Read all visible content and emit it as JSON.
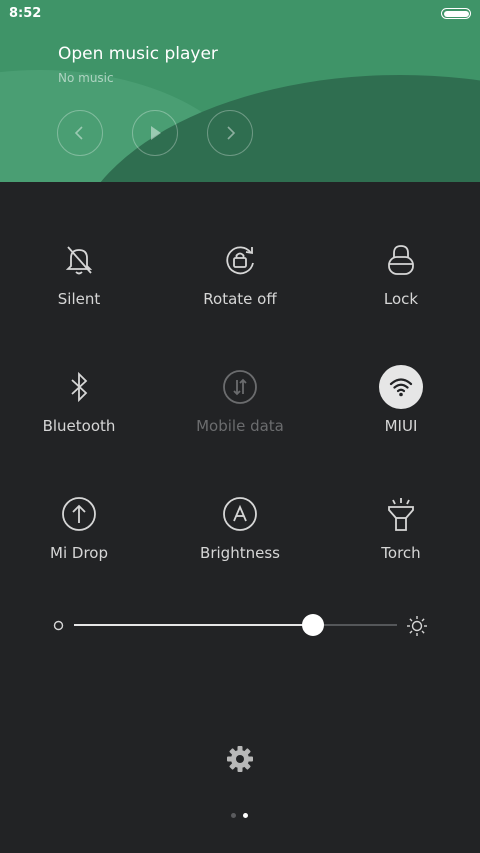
{
  "status_bar": {
    "time": "8:52"
  },
  "music": {
    "title": "Open music player",
    "subtitle": "No music",
    "prev_icon": "chevron-left-icon",
    "play_icon": "play-icon",
    "next_icon": "chevron-right-icon"
  },
  "toggles": [
    {
      "label": "Silent",
      "icon": "bell-off-icon",
      "state": "off"
    },
    {
      "label": "Rotate off",
      "icon": "rotate-lock-icon",
      "state": "off"
    },
    {
      "label": "Lock",
      "icon": "lock-icon",
      "state": "off"
    },
    {
      "label": "Bluetooth",
      "icon": "bluetooth-icon",
      "state": "off"
    },
    {
      "label": "Mobile data",
      "icon": "mobile-data-icon",
      "state": "disabled"
    },
    {
      "label": "MIUI",
      "icon": "wifi-icon",
      "state": "on"
    },
    {
      "label": "Mi Drop",
      "icon": "upload-arrow-icon",
      "state": "off"
    },
    {
      "label": "Brightness",
      "icon": "auto-brightness-icon",
      "state": "off"
    },
    {
      "label": "Torch",
      "icon": "flashlight-icon",
      "state": "off"
    }
  ],
  "brightness_slider": {
    "level": 0.74
  },
  "pager": {
    "pages": 2,
    "current": 2
  },
  "colors": {
    "accent": "#3f9468",
    "background": "#222325",
    "active_tile": "#e6e6e6"
  }
}
